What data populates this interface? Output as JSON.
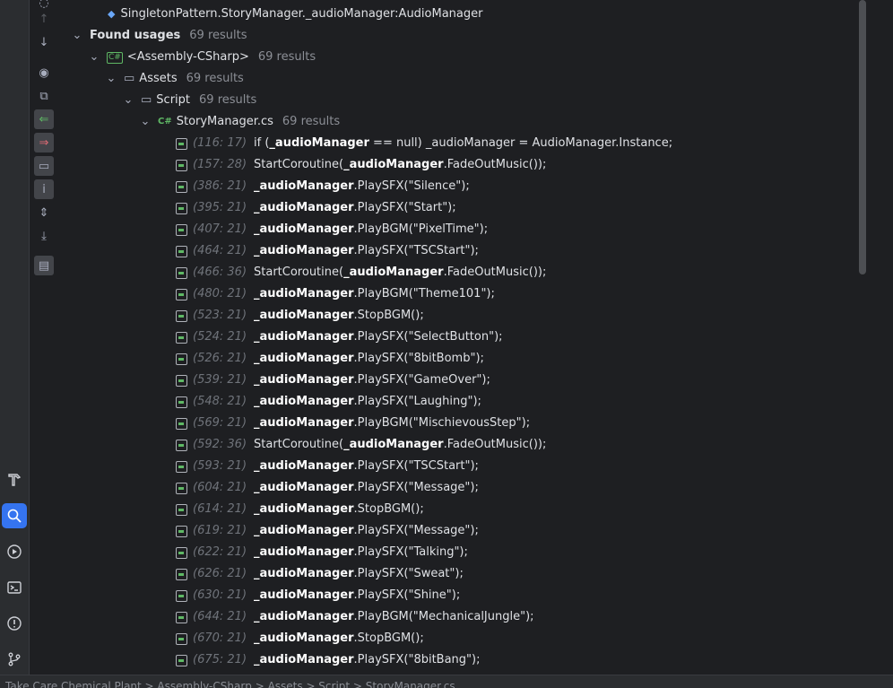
{
  "toolbar": {
    "icons": [
      "settings-icon",
      "arrow-up-icon",
      "arrow-down-icon",
      "eye-icon",
      "group-icon",
      "read-usages-icon",
      "write-usages-icon",
      "directory-icon",
      "info-icon",
      "expand-all-icon",
      "collapse-all-icon",
      "preview-icon"
    ]
  },
  "sidebar": {
    "icons": [
      "hammer-icon",
      "find-icon",
      "run-icon",
      "terminal-icon",
      "problems-icon",
      "git-icon"
    ]
  },
  "tree": {
    "target_label": "SingletonPattern.StoryManager._audioManager:AudioManager",
    "found_label": "Found usages",
    "found_count": "69 results",
    "assembly_label": "<Assembly-CSharp>",
    "assembly_badge": "C#",
    "assembly_count": "69 results",
    "assets_label": "Assets",
    "assets_count": "69 results",
    "script_label": "Script",
    "script_count": "69 results",
    "file_label": "StoryManager.cs",
    "file_badge": "C#",
    "file_count": "69 results"
  },
  "usages": [
    {
      "loc": "(116: 17)",
      "pre": "if (",
      "bold": "_audioManager",
      "post": " == null) _audioManager = AudioManager.Instance;"
    },
    {
      "loc": "(157: 28)",
      "pre": "StartCoroutine(",
      "bold": "_audioManager",
      "post": ".FadeOutMusic());"
    },
    {
      "loc": "(386: 21)",
      "pre": "",
      "bold": "_audioManager",
      "post": ".PlaySFX(\"Silence\");"
    },
    {
      "loc": "(395: 21)",
      "pre": "",
      "bold": "_audioManager",
      "post": ".PlaySFX(\"Start\");"
    },
    {
      "loc": "(407: 21)",
      "pre": "",
      "bold": "_audioManager",
      "post": ".PlayBGM(\"PixelTime\");"
    },
    {
      "loc": "(464: 21)",
      "pre": "",
      "bold": "_audioManager",
      "post": ".PlaySFX(\"TSCStart\");"
    },
    {
      "loc": "(466: 36)",
      "pre": "StartCoroutine(",
      "bold": "_audioManager",
      "post": ".FadeOutMusic());"
    },
    {
      "loc": "(480: 21)",
      "pre": "",
      "bold": "_audioManager",
      "post": ".PlayBGM(\"Theme101\");"
    },
    {
      "loc": "(523: 21)",
      "pre": "",
      "bold": "_audioManager",
      "post": ".StopBGM();"
    },
    {
      "loc": "(524: 21)",
      "pre": "",
      "bold": "_audioManager",
      "post": ".PlaySFX(\"SelectButton\");"
    },
    {
      "loc": "(526: 21)",
      "pre": "",
      "bold": "_audioManager",
      "post": ".PlaySFX(\"8bitBomb\");"
    },
    {
      "loc": "(539: 21)",
      "pre": "",
      "bold": "_audioManager",
      "post": ".PlaySFX(\"GameOver\");"
    },
    {
      "loc": "(548: 21)",
      "pre": "",
      "bold": "_audioManager",
      "post": ".PlaySFX(\"Laughing\");"
    },
    {
      "loc": "(569: 21)",
      "pre": "",
      "bold": "_audioManager",
      "post": ".PlayBGM(\"MischievousStep\");"
    },
    {
      "loc": "(592: 36)",
      "pre": "StartCoroutine(",
      "bold": "_audioManager",
      "post": ".FadeOutMusic());"
    },
    {
      "loc": "(593: 21)",
      "pre": "",
      "bold": "_audioManager",
      "post": ".PlaySFX(\"TSCStart\");"
    },
    {
      "loc": "(604: 21)",
      "pre": "",
      "bold": "_audioManager",
      "post": ".PlaySFX(\"Message\");"
    },
    {
      "loc": "(614: 21)",
      "pre": "",
      "bold": "_audioManager",
      "post": ".StopBGM();"
    },
    {
      "loc": "(619: 21)",
      "pre": "",
      "bold": "_audioManager",
      "post": ".PlaySFX(\"Message\");"
    },
    {
      "loc": "(622: 21)",
      "pre": "",
      "bold": "_audioManager",
      "post": ".PlaySFX(\"Talking\");"
    },
    {
      "loc": "(626: 21)",
      "pre": "",
      "bold": "_audioManager",
      "post": ".PlaySFX(\"Sweat\");"
    },
    {
      "loc": "(630: 21)",
      "pre": "",
      "bold": "_audioManager",
      "post": ".PlaySFX(\"Shine\");"
    },
    {
      "loc": "(644: 21)",
      "pre": "",
      "bold": "_audioManager",
      "post": ".PlayBGM(\"MechanicalJungle\");"
    },
    {
      "loc": "(670: 21)",
      "pre": "",
      "bold": "_audioManager",
      "post": ".StopBGM();"
    },
    {
      "loc": "(675: 21)",
      "pre": "",
      "bold": "_audioManager",
      "post": ".PlaySFX(\"8bitBang\");"
    }
  ],
  "statusbar": {
    "breadcrumb": "Take Care Chemical Plant > Assembly-CSharp > Assets > Script > StoryManager.cs"
  }
}
